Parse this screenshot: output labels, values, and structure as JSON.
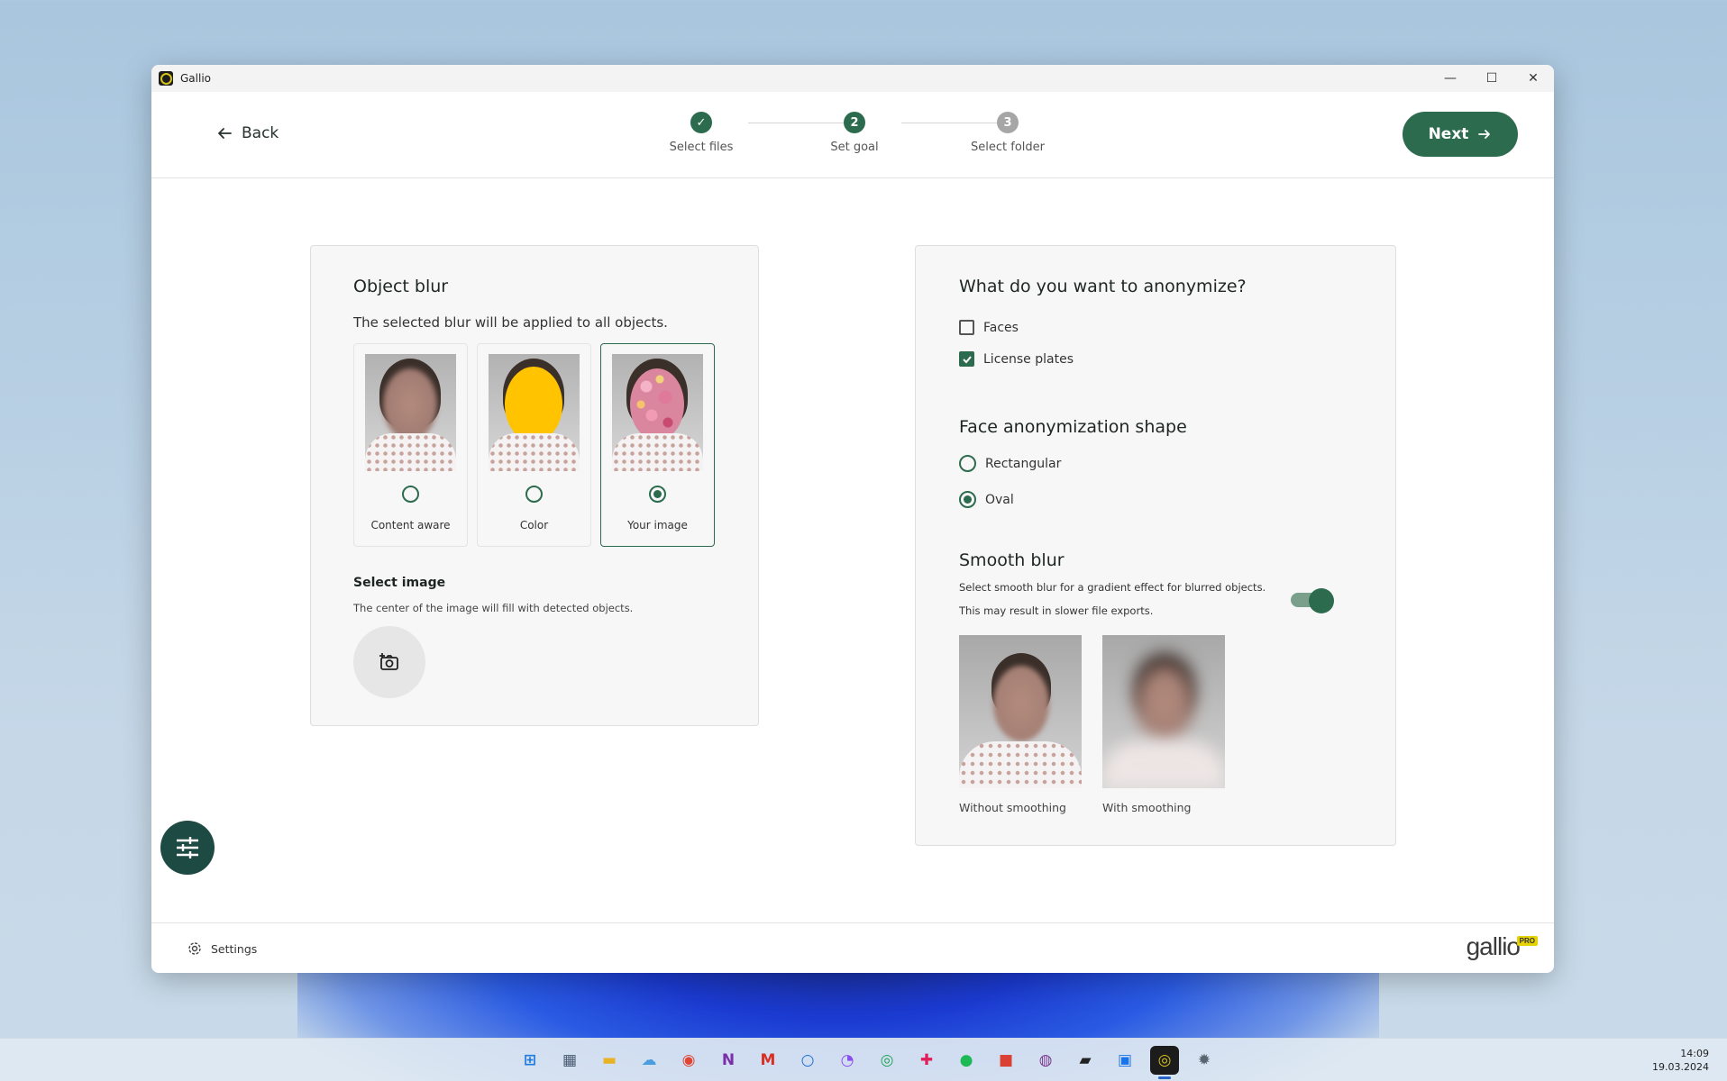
{
  "window": {
    "title": "Gallio",
    "minimize": "—",
    "maximize": "☐",
    "close": "✕"
  },
  "header": {
    "back_label": "Back",
    "next_label": "Next",
    "steps": [
      {
        "label": "Select files",
        "marker": "✓",
        "state": "done"
      },
      {
        "label": "Set goal",
        "marker": "2",
        "state": "active"
      },
      {
        "label": "Select folder",
        "marker": "3",
        "state": "todo"
      }
    ]
  },
  "object_blur": {
    "title": "Object blur",
    "subtitle": "The selected blur will be applied to all objects.",
    "options": [
      {
        "label": "Content aware",
        "selected": false
      },
      {
        "label": "Color",
        "selected": false
      },
      {
        "label": "Your image",
        "selected": true
      }
    ],
    "select_image_title": "Select image",
    "select_image_desc": "The center of the image will fill with detected objects.",
    "camera_icon": "camera-add-icon"
  },
  "anonymize": {
    "title": "What do you want to anonymize?",
    "faces_label": "Faces",
    "faces_checked": false,
    "plates_label": "License plates",
    "plates_checked": true,
    "shape_title": "Face anonymization shape",
    "rect_label": "Rectangular",
    "oval_label": "Oval",
    "shape_selected": "Oval",
    "smooth_title": "Smooth blur",
    "smooth_desc_1": "Select smooth blur for a gradient effect for blurred objects.",
    "smooth_desc_2": "This may result in slower file exports.",
    "smooth_enabled": true,
    "without_label": "Without smoothing",
    "with_label": "With smoothing"
  },
  "footer": {
    "settings_label": "Settings",
    "brand": "gallio",
    "brand_badge": "PRO"
  },
  "taskbar": {
    "icons": [
      "start-icon",
      "calculator-icon",
      "file-explorer-icon",
      "weather-icon",
      "chrome-icon",
      "onenote-icon",
      "gmail-icon",
      "cortana-icon",
      "messenger-icon",
      "whatsapp-icon",
      "slack-icon",
      "spotify-icon",
      "todoist-icon",
      "focus-icon",
      "notes-icon",
      "calendar-icon",
      "gallio-icon",
      "settings-gear-icon"
    ],
    "time": "14:09",
    "date": "19.03.2024"
  },
  "colors": {
    "accent": "#2d6b4f",
    "fab": "#1e4a44",
    "color_option": "#ffc300"
  }
}
